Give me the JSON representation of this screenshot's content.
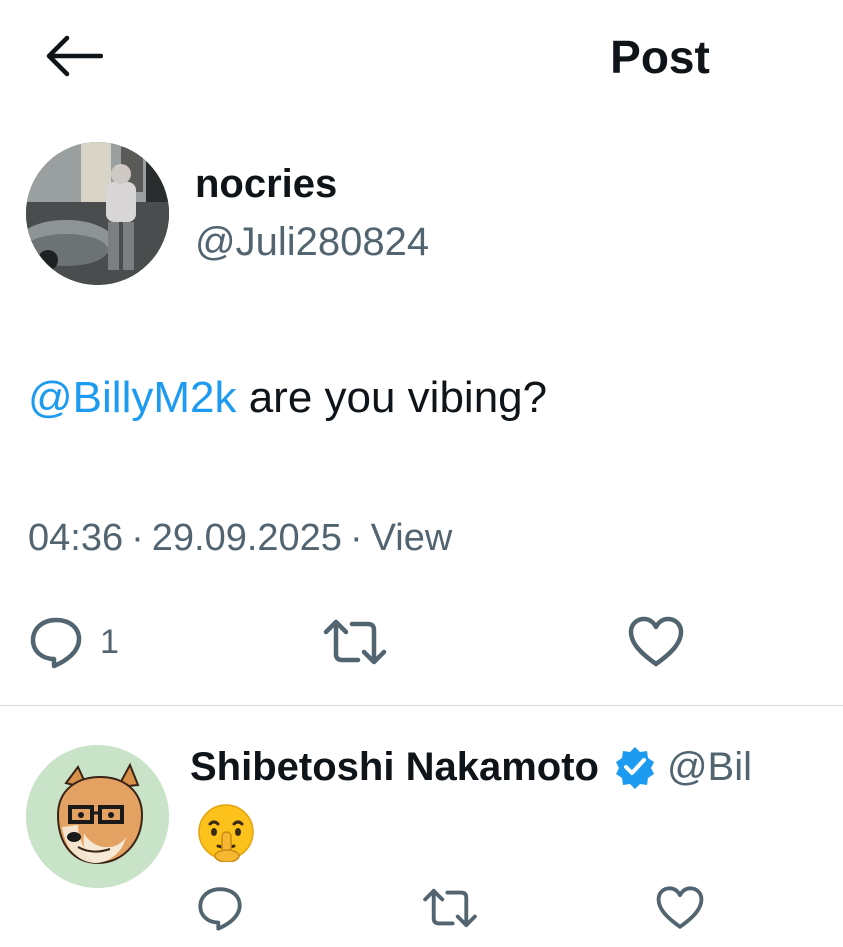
{
  "header": {
    "title": "Post"
  },
  "post": {
    "author_name": "nocries",
    "author_handle": "@Juli280824",
    "mention": "@BillyM2k",
    "text": " are you vibing?",
    "time": "04:36",
    "separator": "·",
    "date": "29.09.2025",
    "view_label": "View",
    "reply_count": "1"
  },
  "reply": {
    "author_name": "Shibetoshi Nakamoto",
    "author_handle": "@Bil",
    "emoji_icon": "shushing-face-emoji"
  },
  "colors": {
    "text": "#0f1419",
    "secondary": "#536471",
    "link": "#1d9bf0",
    "divider": "#cfd9de"
  }
}
